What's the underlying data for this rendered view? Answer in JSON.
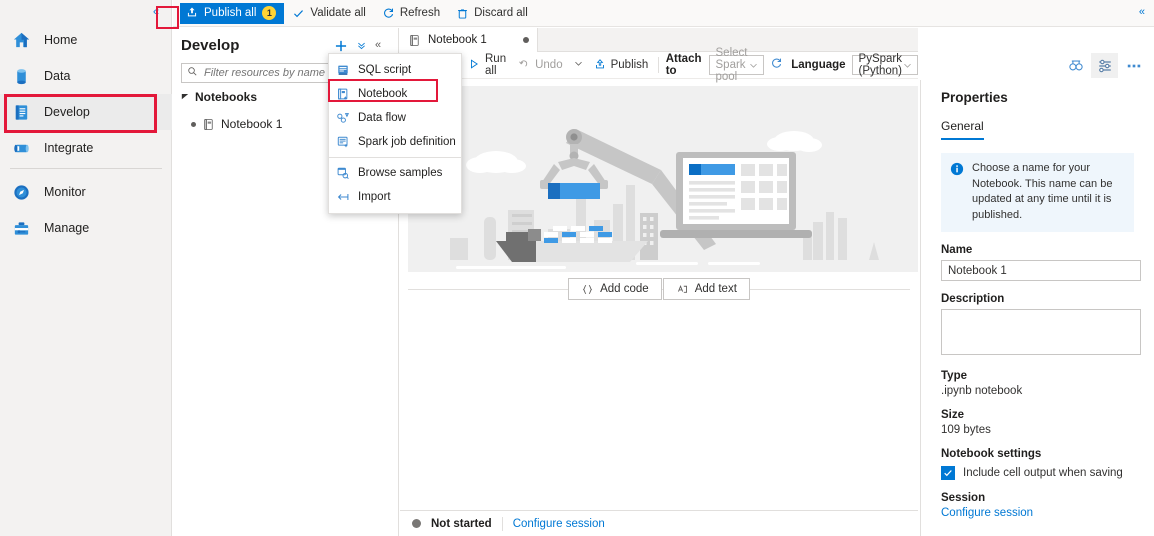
{
  "left_rail": {
    "collapse_icon": "double-chevron-left-icon",
    "items": [
      {
        "label": "Home",
        "icon": "home-icon",
        "selected": false
      },
      {
        "label": "Data",
        "icon": "database-icon",
        "selected": false
      },
      {
        "label": "Develop",
        "icon": "document-icon",
        "selected": true
      },
      {
        "label": "Integrate",
        "icon": "pipeline-icon",
        "selected": false
      },
      {
        "label": "Monitor",
        "icon": "gauge-icon",
        "selected": false
      },
      {
        "label": "Manage",
        "icon": "toolbox-icon",
        "selected": false
      }
    ]
  },
  "command_bar": {
    "publish_all": {
      "label": "Publish all",
      "badge": "1",
      "icon": "publish-icon"
    },
    "validate_all": {
      "label": "Validate all",
      "icon": "check-icon"
    },
    "refresh": {
      "label": "Refresh",
      "icon": "refresh-icon"
    },
    "discard_all": {
      "label": "Discard all",
      "icon": "trash-icon"
    },
    "collapse_icon": "double-chevron-left-icon"
  },
  "develop_panel": {
    "title": "Develop",
    "add_icon": "plus-icon",
    "expand_all_icon": "double-chevron-down-icon",
    "collapse_icon": "double-chevron-left-icon",
    "filter": {
      "placeholder": "Filter resources by name",
      "value": "",
      "icon": "search-icon"
    },
    "tree": {
      "group_label": "Notebooks",
      "items": [
        {
          "label": "Notebook 1",
          "icon": "notebook-icon"
        }
      ]
    }
  },
  "new_menu": {
    "items": [
      {
        "label": "SQL script",
        "icon": "sql-script-icon",
        "highlighted": false
      },
      {
        "label": "Notebook",
        "icon": "notebook-add-icon",
        "highlighted": true
      },
      {
        "label": "Data flow",
        "icon": "data-flow-icon",
        "highlighted": false
      },
      {
        "label": "Spark job definition",
        "icon": "spark-job-icon",
        "highlighted": false
      },
      {
        "label": "Browse samples",
        "icon": "browse-samples-icon",
        "highlighted": false
      },
      {
        "label": "Import",
        "icon": "import-icon",
        "highlighted": false
      }
    ]
  },
  "editor": {
    "tab": {
      "label": "Notebook 1",
      "icon": "notebook-icon",
      "dirty": true
    },
    "toolbar": {
      "run_all": {
        "label": "Run all",
        "icon": "play-icon"
      },
      "undo": {
        "label": "Undo",
        "icon": "undo-icon",
        "disabled": true
      },
      "undo_dropdown_icon": "chevron-down-icon",
      "publish": {
        "label": "Publish",
        "icon": "publish-icon"
      },
      "attach_to_label": "Attach to",
      "spark_pool": {
        "value": "",
        "placeholder": "Select Spark pool",
        "chevron": "chevron-down-icon"
      },
      "refresh_icon": "refresh-icon",
      "language_label": "Language",
      "language": {
        "value": "PySpark (Python)",
        "chevron": "chevron-down-icon"
      },
      "variables_icon": "variables-icon",
      "properties_icon": "sliders-icon",
      "more_icon": "ellipsis-icon"
    },
    "add_code": {
      "label": "Add code",
      "icon": "code-braces-icon"
    },
    "add_text": {
      "label": "Add text",
      "icon": "text-box-icon"
    },
    "status": {
      "state": "Not started",
      "configure_session": "Configure session"
    }
  },
  "properties": {
    "title": "Properties",
    "tab": "General",
    "info_icon": "info-icon",
    "info_text": "Choose a name for your Notebook. This name can be updated at any time until it is published.",
    "name_label": "Name",
    "name_value": "Notebook 1",
    "description_label": "Description",
    "description_value": "",
    "type_label": "Type",
    "type_value": ".ipynb notebook",
    "size_label": "Size",
    "size_value": "109 bytes",
    "settings_label": "Notebook settings",
    "include_output_label": "Include cell output when saving",
    "include_output_checked": true,
    "session_label": "Session",
    "configure_session_link": "Configure session"
  },
  "colors": {
    "accent": "#0078d4",
    "highlight_red": "#e3183a",
    "badge_yellow": "#ffd335",
    "info_bg": "#eff6fc",
    "rail_bg": "#f3f2f1",
    "canvas_bg": "#f0f0f0"
  }
}
